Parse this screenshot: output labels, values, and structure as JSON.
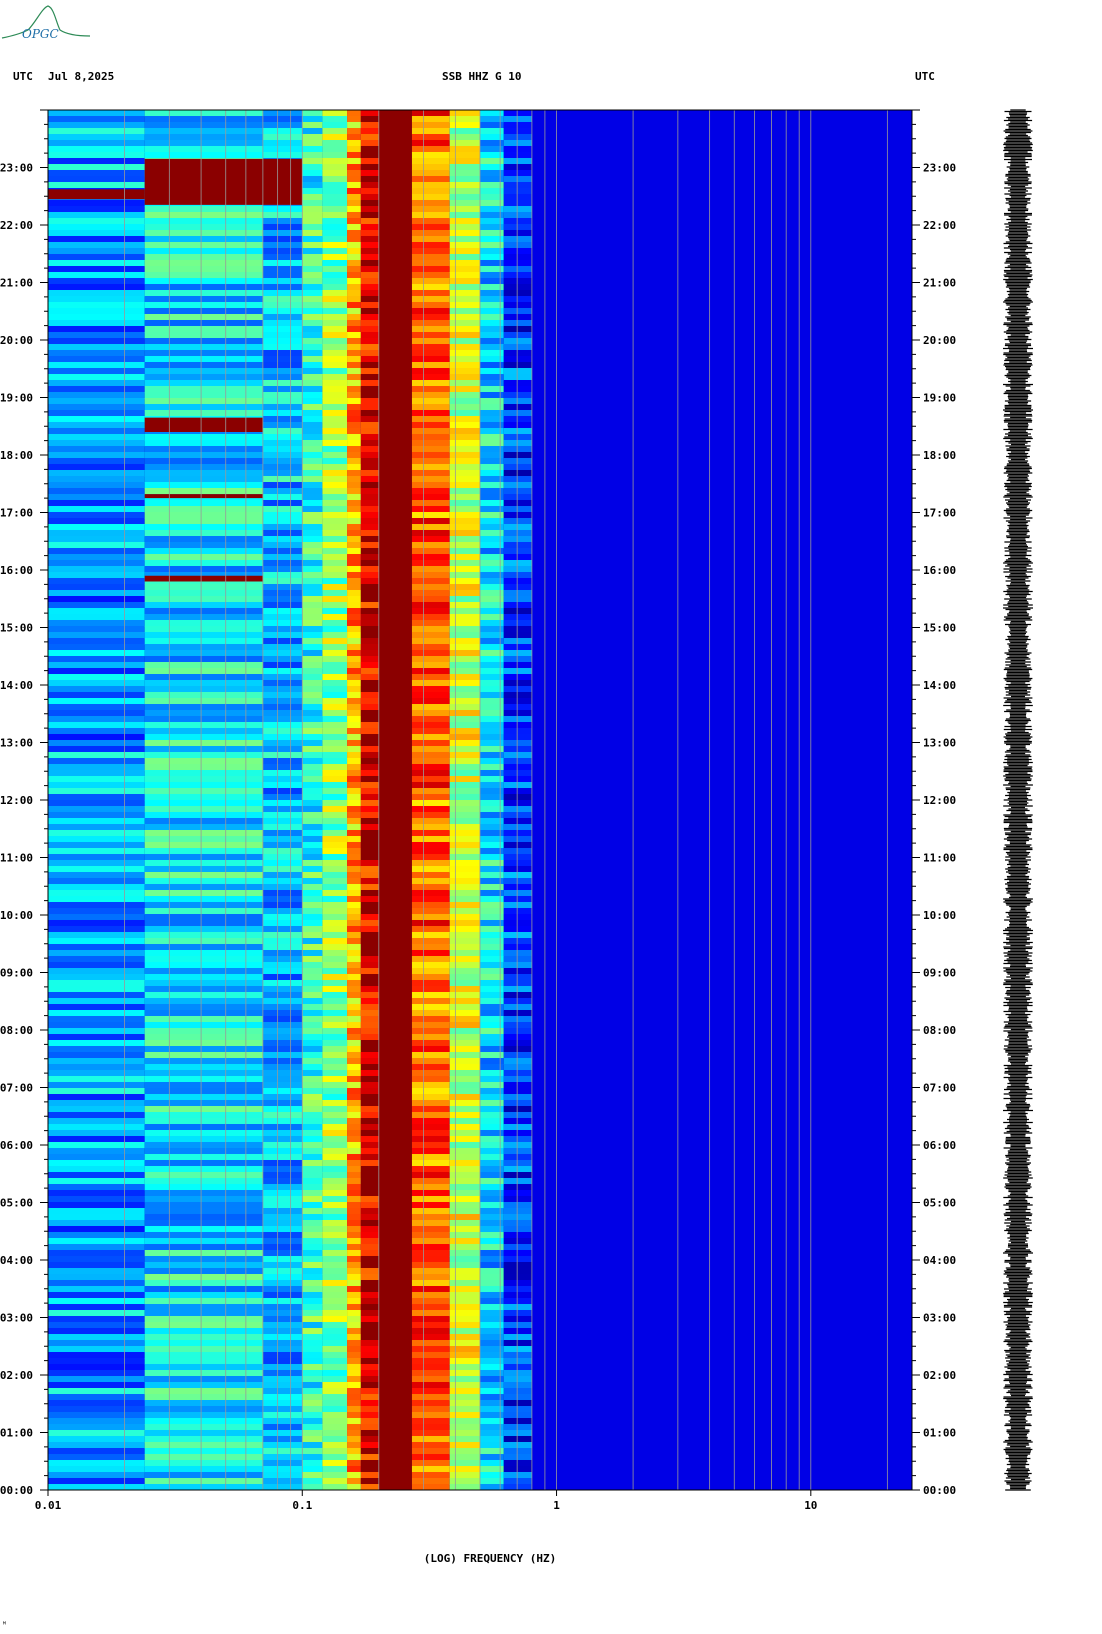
{
  "header": {
    "left_tz": "UTC",
    "date": "Jul 8,2025",
    "station": "SSB HHZ G 10",
    "right_tz": "UTC"
  },
  "logo_text": "OPGC",
  "footer_mark": "ᴹ",
  "colors": {
    "background": "#00009c",
    "dark_red": "#8b0000",
    "grid": "#999999",
    "trace": "#000000"
  },
  "chart_data": {
    "type": "heatmap",
    "title": "SSB HHZ G 10",
    "xlabel": "(LOG) FREQUENCY (HZ)",
    "ylabel": "UTC",
    "x_scale": "log",
    "xlim": [
      0.01,
      25
    ],
    "x_ticks": [
      {
        "value": 0.01,
        "label": "0.01"
      },
      {
        "value": 0.1,
        "label": "0.1"
      },
      {
        "value": 1,
        "label": "1"
      },
      {
        "value": 10,
        "label": "10"
      }
    ],
    "minor_grid": [
      0.02,
      0.03,
      0.04,
      0.05,
      0.06,
      0.07,
      0.08,
      0.09,
      0.2,
      0.3,
      0.4,
      0.5,
      0.6,
      0.7,
      0.8,
      0.9,
      2,
      3,
      4,
      5,
      6,
      7,
      8,
      9,
      20
    ],
    "ylim_hours": [
      0,
      24
    ],
    "y_ticks": [
      "00:00",
      "01:00",
      "02:00",
      "03:00",
      "04:00",
      "05:00",
      "06:00",
      "07:00",
      "08:00",
      "09:00",
      "10:00",
      "11:00",
      "12:00",
      "13:00",
      "14:00",
      "15:00",
      "16:00",
      "17:00",
      "18:00",
      "19:00",
      "20:00",
      "21:00",
      "22:00",
      "23:00"
    ],
    "bands": [
      {
        "from": 0.01,
        "to": 0.024,
        "level": 0.28
      },
      {
        "from": 0.024,
        "to": 0.07,
        "level": 0.36
      },
      {
        "from": 0.07,
        "to": 0.1,
        "level": 0.32
      },
      {
        "from": 0.1,
        "to": 0.12,
        "level": 0.42
      },
      {
        "from": 0.12,
        "to": 0.15,
        "level": 0.52
      },
      {
        "from": 0.15,
        "to": 0.17,
        "level": 0.7
      },
      {
        "from": 0.17,
        "to": 0.2,
        "level": 0.9
      },
      {
        "from": 0.2,
        "to": 0.27,
        "level": 1.0
      },
      {
        "from": 0.27,
        "to": 0.38,
        "level": 0.78
      },
      {
        "from": 0.38,
        "to": 0.5,
        "level": 0.58
      },
      {
        "from": 0.5,
        "to": 0.62,
        "level": 0.35
      },
      {
        "from": 0.62,
        "to": 0.8,
        "level": 0.18
      },
      {
        "from": 0.8,
        "to": 25,
        "level": 0.06
      }
    ],
    "events": [
      {
        "hour_start": 22.35,
        "hour_end": 23.15,
        "f_from": 0.024,
        "f_to": 0.1
      },
      {
        "hour_start": 22.45,
        "hour_end": 22.62,
        "f_from": 0.01,
        "f_to": 0.024
      },
      {
        "hour_start": 18.4,
        "hour_end": 18.65,
        "f_from": 0.024,
        "f_to": 0.07
      },
      {
        "hour_start": 17.25,
        "hour_end": 17.32,
        "f_from": 0.024,
        "f_to": 0.07
      },
      {
        "hour_start": 15.8,
        "hour_end": 15.9,
        "f_from": 0.024,
        "f_to": 0.07
      }
    ],
    "grid": true
  }
}
